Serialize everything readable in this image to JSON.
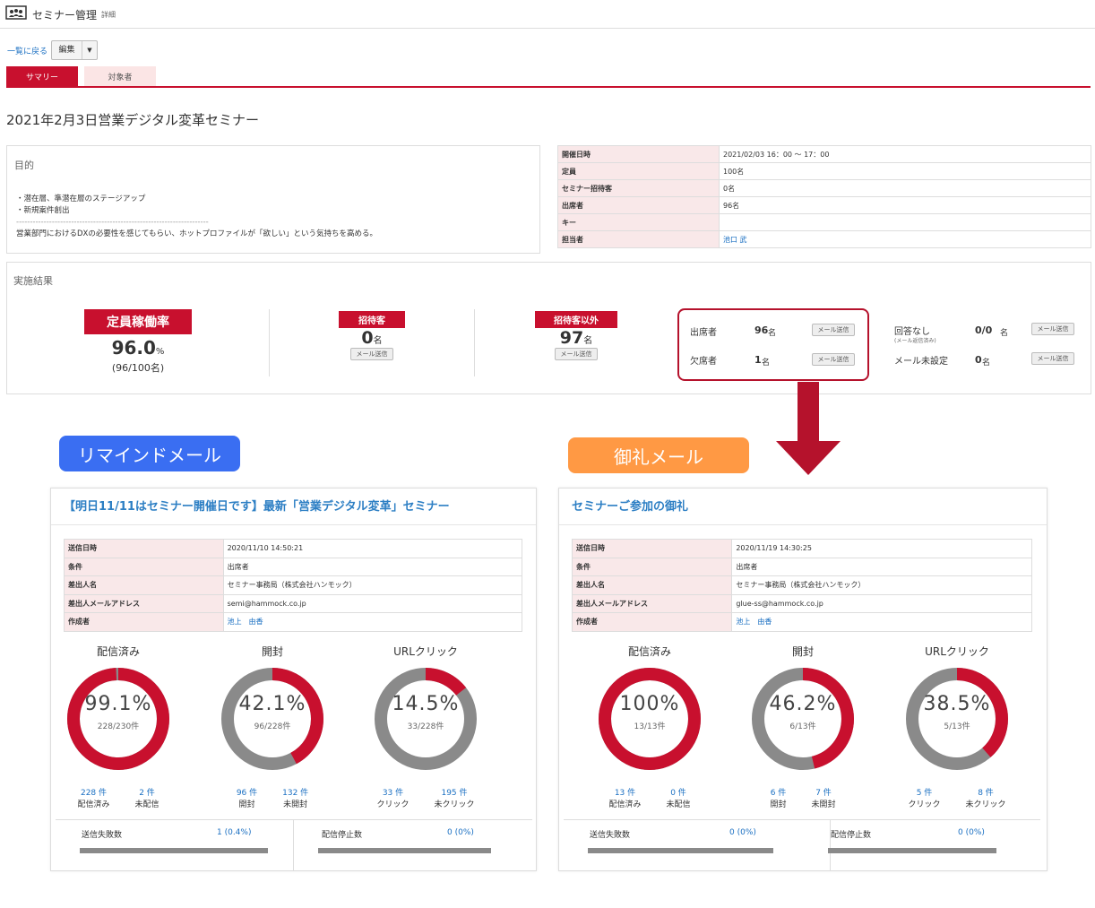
{
  "header": {
    "title": "セミナー管理",
    "subtitle": "詳細"
  },
  "nav": {
    "back": "一覧に戻る",
    "edit": "編集"
  },
  "tabs": [
    {
      "label": "サマリー",
      "active": true
    },
    {
      "label": "対象者",
      "active": false
    }
  ],
  "seminar_title": "2021年2月3日営業デジタル変革セミナー",
  "purpose": {
    "label": "目的",
    "lines": [
      "・潜在層、準潜在層のステージアップ",
      "・新規案件創出",
      "----------------------------------------------------------------------",
      "営業部門におけるDXの必要性を感じてもらい、ホットプロファイルが「欲しい」という気持ちを高める。"
    ]
  },
  "info": [
    {
      "key": "開催日時",
      "value": "2021/02/03 16：00 ～ 17：00"
    },
    {
      "key": "定員",
      "value": "100名"
    },
    {
      "key": "セミナー招待客",
      "value": "0名"
    },
    {
      "key": "出席者",
      "value": "96名"
    },
    {
      "key": "キー",
      "value": ""
    },
    {
      "key": "担当者",
      "value": "池口 武"
    }
  ],
  "results": {
    "label": "実施結果",
    "capacity": {
      "label": "定員稼働率",
      "value": "96.0",
      "unit": "%",
      "detail": "(96/100名)"
    },
    "invited": {
      "label": "招待客",
      "value": "0",
      "unit": "名",
      "button": "メール送信"
    },
    "non_invited": {
      "label": "招待客以外",
      "value": "97",
      "unit": "名",
      "button": "メール送信"
    },
    "attendance": [
      {
        "label": "出席者",
        "value": "96",
        "unit": "名",
        "button": "メール送信"
      },
      {
        "label": "欠席者",
        "value": "1",
        "unit": "名",
        "button": "メール送信"
      }
    ],
    "other": [
      {
        "label": "回答なし",
        "note": "(メール返信済み)",
        "value": "0/0",
        "unit": "名",
        "button": "メール送信"
      },
      {
        "label": "メール未設定",
        "value": "0",
        "unit": "名",
        "button": "メール送信"
      }
    ]
  },
  "callouts": {
    "remind": "リマインドメール",
    "thanks": "御礼メール"
  },
  "colors": {
    "accent": "#c8102e",
    "gray": "#8a8a8a",
    "link": "#1a6fc2",
    "remind": "#3a6ef2",
    "thanks": "#ff9944"
  },
  "cards": [
    {
      "title": "【明日11/11はセミナー開催日です】最新「営業デジタル変革」セミナー",
      "meta": [
        {
          "key": "送信日時",
          "value": "2020/11/10 14:50:21"
        },
        {
          "key": "条件",
          "value": "出席者"
        },
        {
          "key": "差出人名",
          "value": "セミナー事務局（株式会社ハンモック）"
        },
        {
          "key": "差出人メールアドレス",
          "value": "semi@hammock.co.jp"
        },
        {
          "key": "作成者",
          "value": "池上　由香"
        }
      ],
      "donuts": [
        {
          "label": "配信済み",
          "pct_text": "99.1%",
          "pct": 99.1,
          "count": "228/230件",
          "a_num": "228 件",
          "a_label": "配信済み",
          "b_num": "2 件",
          "b_label": "未配信"
        },
        {
          "label": "開封",
          "pct_text": "42.1%",
          "pct": 42.1,
          "count": "96/228件",
          "a_num": "96 件",
          "a_label": "開封",
          "b_num": "132 件",
          "b_label": "未開封"
        },
        {
          "label": "URLクリック",
          "pct_text": "14.5%",
          "pct": 14.5,
          "count": "33/228件",
          "a_num": "33 件",
          "a_label": "クリック",
          "b_num": "195 件",
          "b_label": "未クリック"
        }
      ],
      "footer": [
        {
          "label": "送信失敗数",
          "value": "1 (0.4%)"
        },
        {
          "label": "配信停止数",
          "value": "0 (0%)"
        }
      ]
    },
    {
      "title": "セミナーご参加の御礼",
      "meta": [
        {
          "key": "送信日時",
          "value": "2020/11/19 14:30:25"
        },
        {
          "key": "条件",
          "value": "出席者"
        },
        {
          "key": "差出人名",
          "value": "セミナー事務局（株式会社ハンモック）"
        },
        {
          "key": "差出人メールアドレス",
          "value": "glue-ss@hammock.co.jp"
        },
        {
          "key": "作成者",
          "value": "池上　由香"
        }
      ],
      "donuts": [
        {
          "label": "配信済み",
          "pct_text": "100%",
          "pct": 100,
          "count": "13/13件",
          "a_num": "13 件",
          "a_label": "配信済み",
          "b_num": "0 件",
          "b_label": "未配信"
        },
        {
          "label": "開封",
          "pct_text": "46.2%",
          "pct": 46.2,
          "count": "6/13件",
          "a_num": "6 件",
          "a_label": "開封",
          "b_num": "7 件",
          "b_label": "未開封"
        },
        {
          "label": "URLクリック",
          "pct_text": "38.5%",
          "pct": 38.5,
          "count": "5/13件",
          "a_num": "5 件",
          "a_label": "クリック",
          "b_num": "8 件",
          "b_label": "未クリック"
        }
      ],
      "footer": [
        {
          "label": "送信失敗数",
          "value": "0 (0%)"
        },
        {
          "label": "配信停止数",
          "value": "0 (0%)"
        }
      ]
    }
  ]
}
